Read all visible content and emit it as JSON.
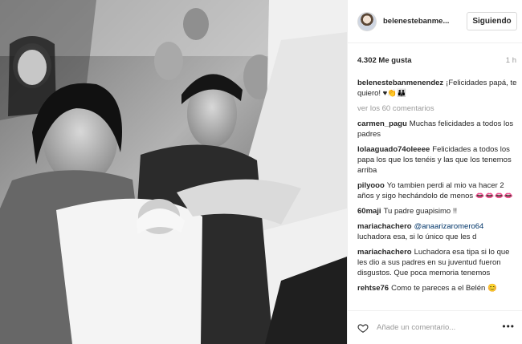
{
  "post": {
    "image_alt": "",
    "username": "belenestebanme...",
    "follow_label": "Siguiendo",
    "likes": "4.302 Me gusta",
    "time": "1 h",
    "view_all": "ver los 60 comentarios",
    "comment_placeholder": "Añade un comentario...",
    "more_label": "•••"
  },
  "comments": [
    {
      "user": "belenestebanmenendez",
      "text": "¡Felicidades papá, te quiero! ♥👏👪"
    },
    {
      "user": "carmen_pagu",
      "text": "Muchas felicidades a todos los padres"
    },
    {
      "user": "lolaaguado74oleeee",
      "text": "Felicidades a todos los papa los que los tenéis y las que los tenemos arriba"
    },
    {
      "user": "pilyooo",
      "text": "Yo tambien perdi al mio va hacer 2 años y sigo hechándolo de menos 👄👄👄👄"
    },
    {
      "user": "60maji",
      "text": "Tu padre guapisimo !!"
    },
    {
      "user": "mariachachero",
      "mention": "@anaarizaromero64",
      "text": "luchadora esa, si lo único que les d"
    },
    {
      "user": "mariachachero",
      "text": "Luchadora esa tipa si lo que les dio a sus padres en su juventud fueron disgustos. Que poca memoria tenemos"
    },
    {
      "user": "rehtse76",
      "text": "Como te pareces a el Belén 😊"
    }
  ],
  "colors": {
    "text": "#262626",
    "muted": "#999999",
    "border": "#dbdbdb",
    "mention": "#003569"
  },
  "icons": [
    "heart-icon",
    "more-options-icon",
    "avatar"
  ]
}
